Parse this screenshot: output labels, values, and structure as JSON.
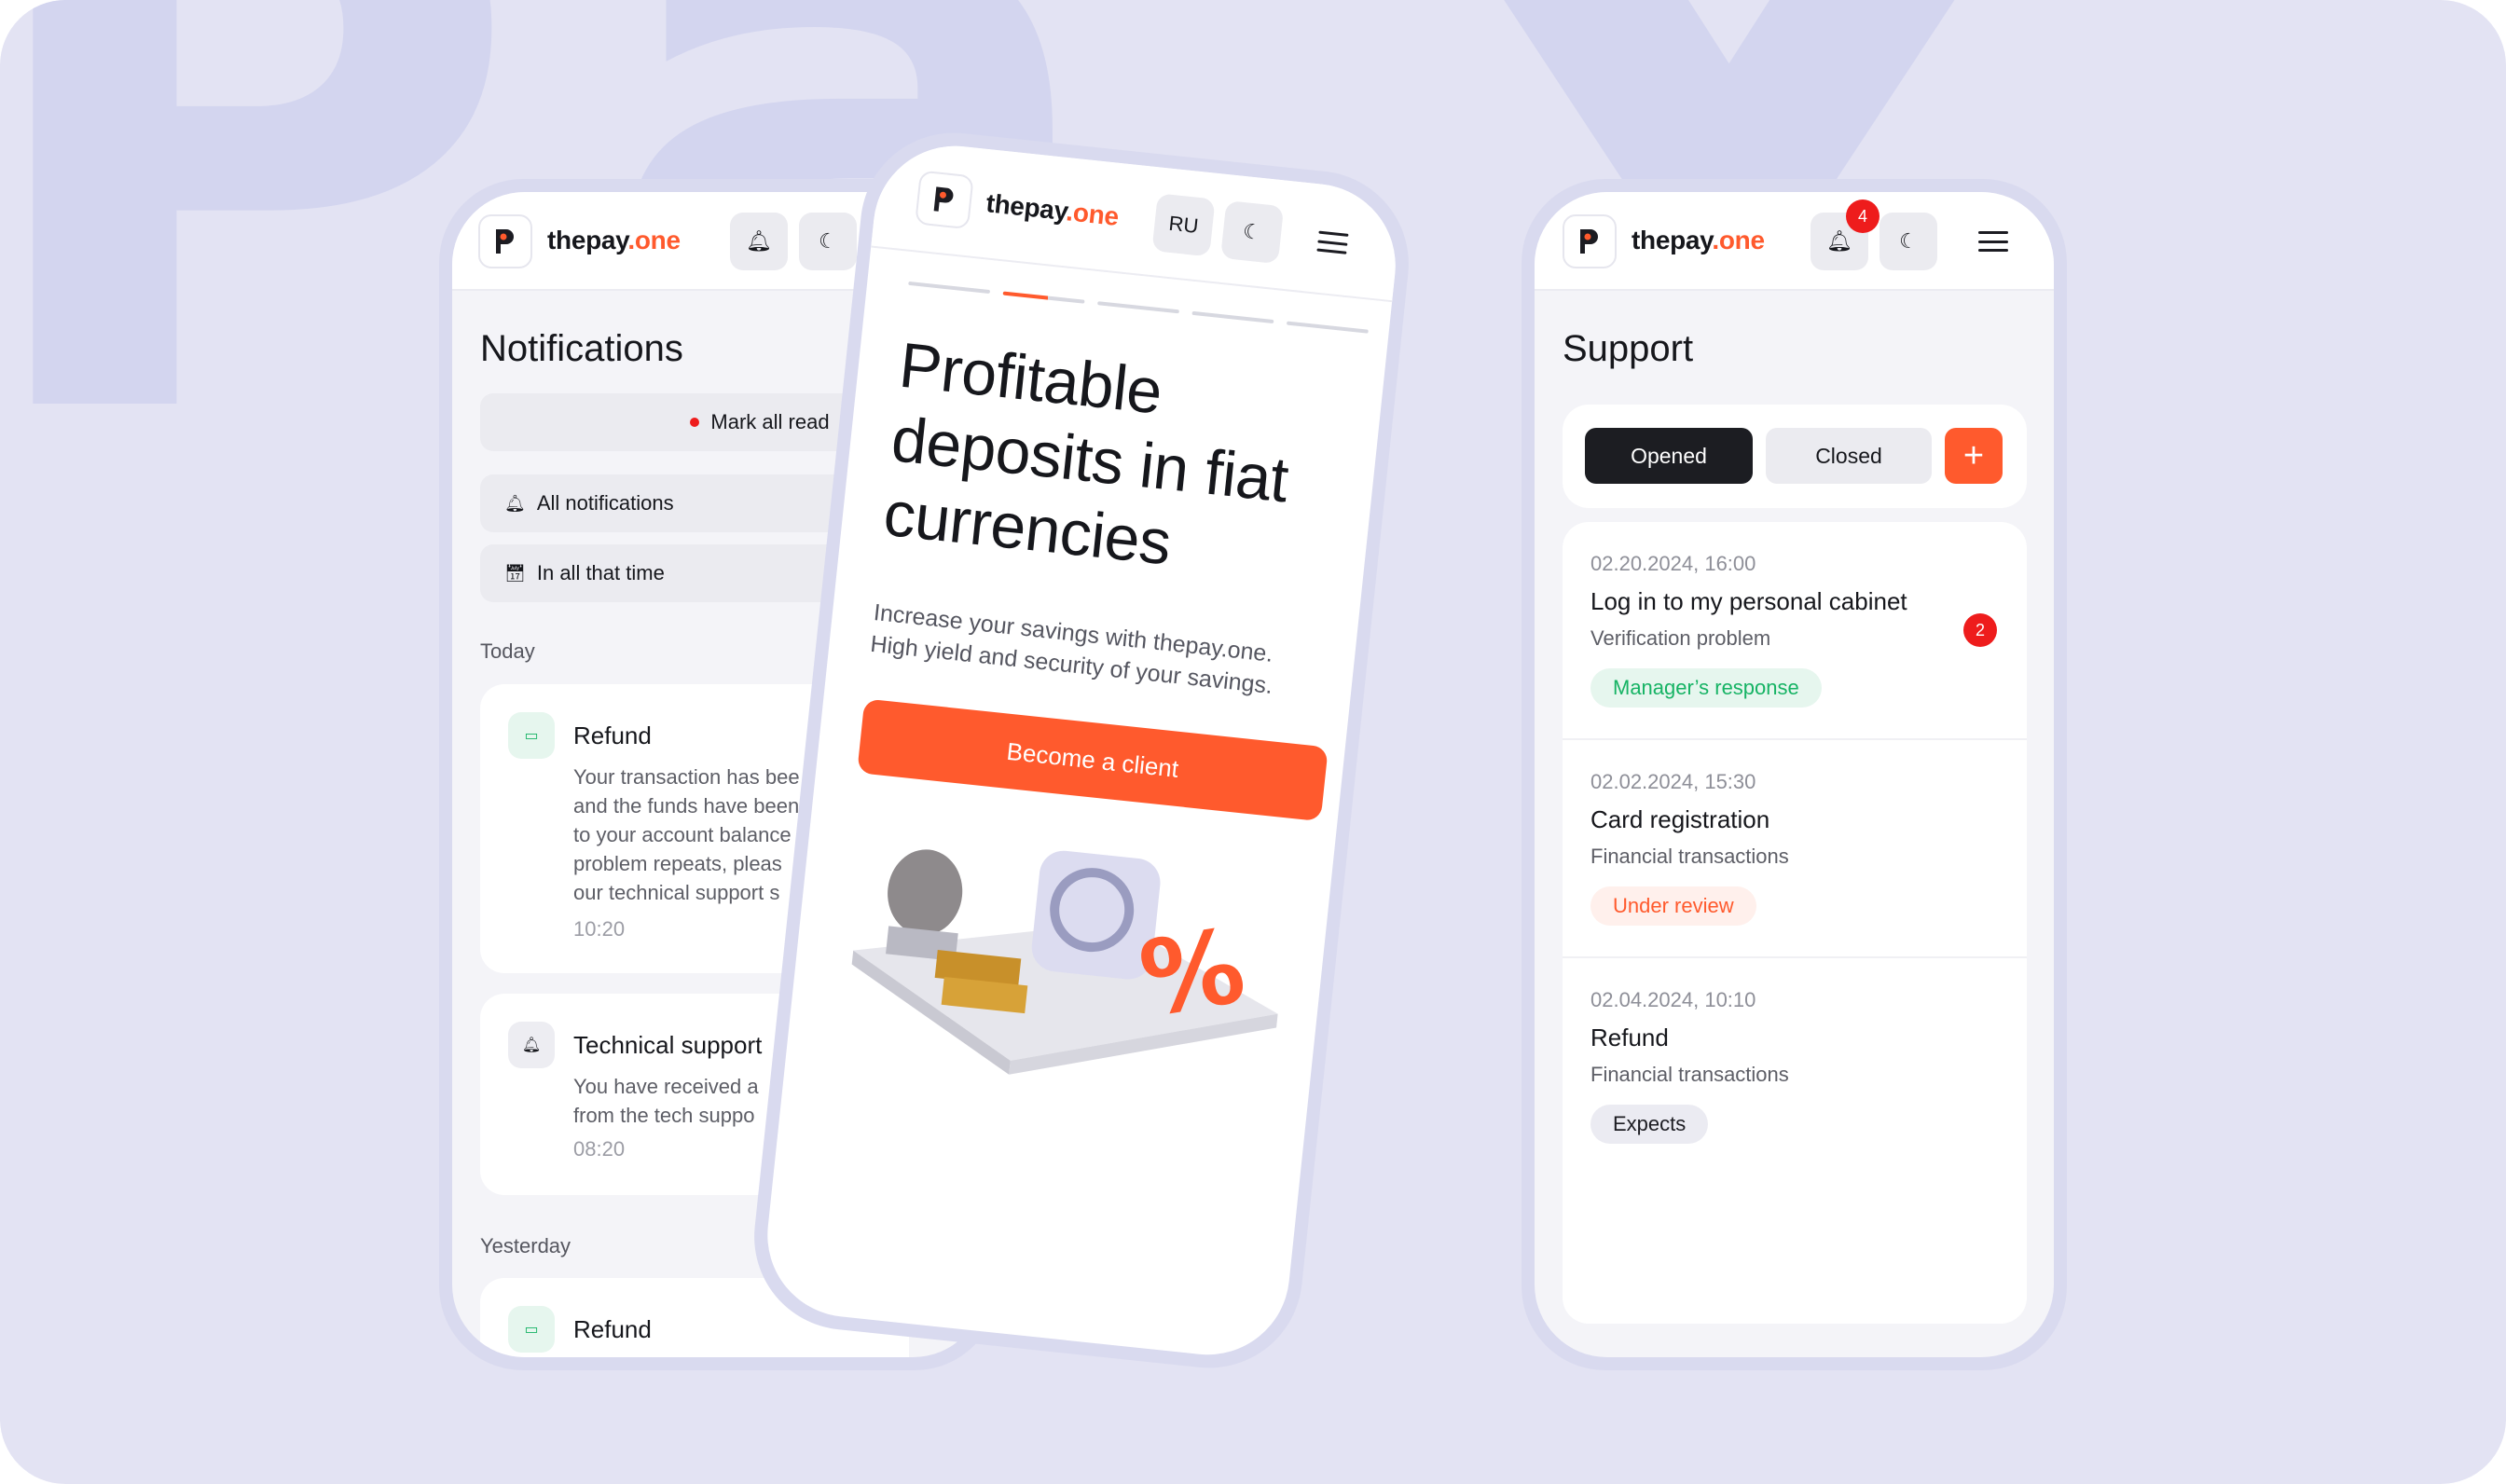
{
  "brand": {
    "name_main": "thepay",
    "name_accent": ".one",
    "accent_color": "#ff5a2d"
  },
  "notifications_screen": {
    "title": "Notifications",
    "mark_all_read": "Mark all read",
    "filter_type": "All notifications",
    "filter_period": "In all that time",
    "groups": [
      {
        "label": "Today",
        "items": [
          {
            "icon": "card-icon",
            "title": "Refund",
            "lines": [
              "Your transaction has bee",
              "and the funds have been",
              "to your account balance",
              "problem repeats, pleas",
              "our technical support s"
            ],
            "time": "10:20"
          },
          {
            "icon": "bell-icon",
            "title": "Technical support",
            "lines": [
              "You have received a",
              "from the tech suppo"
            ],
            "time": "08:20"
          }
        ]
      },
      {
        "label": "Yesterday",
        "items": [
          {
            "icon": "card-icon",
            "title": "Refund"
          }
        ]
      }
    ]
  },
  "landing_screen": {
    "language": "RU",
    "slider": {
      "count": 5,
      "active": 2
    },
    "headline": [
      "Profitable",
      "deposits in fiat",
      "currencies"
    ],
    "subtitle": [
      "Increase your savings with thepay.one.",
      "High yield and security of your savings."
    ],
    "cta": "Become a client"
  },
  "support_screen": {
    "title": "Support",
    "notification_count": "4",
    "tabs": [
      {
        "label": "Opened",
        "active": true
      },
      {
        "label": "Closed",
        "active": false
      }
    ],
    "add_icon": "plus-icon",
    "tickets": [
      {
        "date": "02.20.2024, 16:00",
        "title": "Log in to my personal cabinet",
        "category": "Verification problem",
        "status": "Manager’s response",
        "status_color": "#16b364",
        "unread": "2"
      },
      {
        "date": "02.02.2024, 15:30",
        "title": "Card registration",
        "category": "Financial transactions",
        "status": "Under review",
        "status_color": "#ff5a2d"
      },
      {
        "date": "02.04.2024, 10:10",
        "title": "Refund",
        "category": "Financial transactions",
        "status": "Expects",
        "status_color": "#1c1c22"
      }
    ]
  }
}
